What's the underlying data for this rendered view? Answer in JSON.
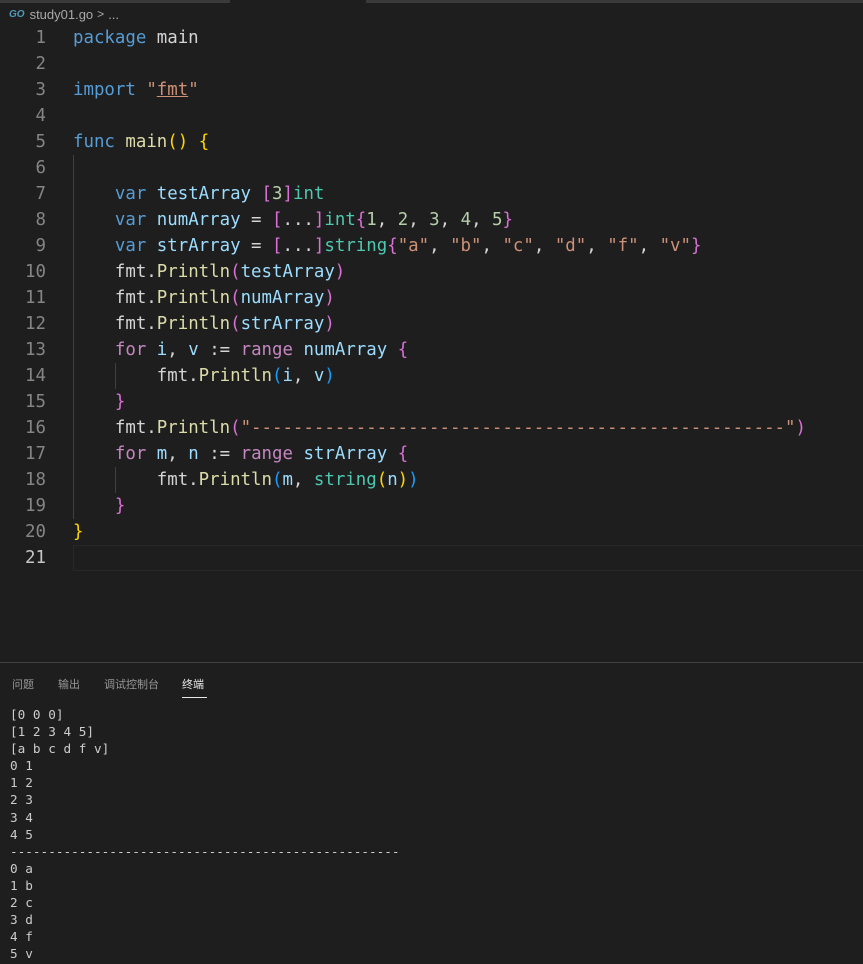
{
  "breadcrumb": {
    "go_icon": "GO",
    "file": "study01.go",
    "sep": ">",
    "more": "..."
  },
  "editor": {
    "line_numbers": [
      "1",
      "2",
      "3",
      "4",
      "5",
      "6",
      "7",
      "8",
      "9",
      "10",
      "11",
      "12",
      "13",
      "14",
      "15",
      "16",
      "17",
      "18",
      "19",
      "20",
      "21"
    ],
    "current_line": "21"
  },
  "panel": {
    "tabs": [
      "问题",
      "输出",
      "调试控制台",
      "终端"
    ],
    "active_tab": "终端",
    "terminal_lines": [
      "[0 0 0]",
      "[1 2 3 4 5]",
      "[a b c d f v]",
      "0 1",
      "1 2",
      "2 3",
      "3 4",
      "4 5",
      "---------------------------------------------------",
      "0 a",
      "1 b",
      "2 c",
      "3 d",
      "4 f",
      "5 v"
    ]
  },
  "colors": {
    "background": "#1e1e1e",
    "keyword": "#569cd6",
    "control": "#c586c0",
    "function": "#dcdcaa",
    "string": "#ce9178",
    "number": "#b5cea8",
    "type": "#4ec9b0",
    "variable": "#9cdcfe"
  },
  "code_lines": [
    [
      [
        "kw",
        "package"
      ],
      [
        "plain",
        " main"
      ]
    ],
    [],
    [
      [
        "kw",
        "import"
      ],
      [
        "plain",
        " "
      ],
      [
        "str",
        "\""
      ],
      [
        "stru",
        "fmt"
      ],
      [
        "str",
        "\""
      ]
    ],
    [],
    [
      [
        "kw",
        "func"
      ],
      [
        "plain",
        " "
      ],
      [
        "fn",
        "main"
      ],
      [
        "b1",
        "()"
      ],
      [
        "plain",
        " "
      ],
      [
        "b1",
        "{"
      ]
    ],
    [],
    [
      [
        "plain",
        "    "
      ],
      [
        "kw",
        "var"
      ],
      [
        "plain",
        " "
      ],
      [
        "var",
        "testArray"
      ],
      [
        "plain",
        " "
      ],
      [
        "b2",
        "["
      ],
      [
        "num",
        "3"
      ],
      [
        "b2",
        "]"
      ],
      [
        "ty",
        "int"
      ]
    ],
    [
      [
        "plain",
        "    "
      ],
      [
        "kw",
        "var"
      ],
      [
        "plain",
        " "
      ],
      [
        "var",
        "numArray"
      ],
      [
        "plain",
        " = "
      ],
      [
        "b2",
        "["
      ],
      [
        "plain",
        "..."
      ],
      [
        "b2",
        "]"
      ],
      [
        "ty",
        "int"
      ],
      [
        "b2",
        "{"
      ],
      [
        "num",
        "1"
      ],
      [
        "plain",
        ", "
      ],
      [
        "num",
        "2"
      ],
      [
        "plain",
        ", "
      ],
      [
        "num",
        "3"
      ],
      [
        "plain",
        ", "
      ],
      [
        "num",
        "4"
      ],
      [
        "plain",
        ", "
      ],
      [
        "num",
        "5"
      ],
      [
        "b2",
        "}"
      ]
    ],
    [
      [
        "plain",
        "    "
      ],
      [
        "kw",
        "var"
      ],
      [
        "plain",
        " "
      ],
      [
        "var",
        "strArray"
      ],
      [
        "plain",
        " = "
      ],
      [
        "b2",
        "["
      ],
      [
        "plain",
        "..."
      ],
      [
        "b2",
        "]"
      ],
      [
        "ty",
        "string"
      ],
      [
        "b2",
        "{"
      ],
      [
        "str",
        "\"a\""
      ],
      [
        "plain",
        ", "
      ],
      [
        "str",
        "\"b\""
      ],
      [
        "plain",
        ", "
      ],
      [
        "str",
        "\"c\""
      ],
      [
        "plain",
        ", "
      ],
      [
        "str",
        "\"d\""
      ],
      [
        "plain",
        ", "
      ],
      [
        "str",
        "\"f\""
      ],
      [
        "plain",
        ", "
      ],
      [
        "str",
        "\"v\""
      ],
      [
        "b2",
        "}"
      ]
    ],
    [
      [
        "plain",
        "    "
      ],
      [
        "plain",
        "fmt."
      ],
      [
        "fn",
        "Println"
      ],
      [
        "b2",
        "("
      ],
      [
        "var",
        "testArray"
      ],
      [
        "b2",
        ")"
      ]
    ],
    [
      [
        "plain",
        "    "
      ],
      [
        "plain",
        "fmt."
      ],
      [
        "fn",
        "Println"
      ],
      [
        "b2",
        "("
      ],
      [
        "var",
        "numArray"
      ],
      [
        "b2",
        ")"
      ]
    ],
    [
      [
        "plain",
        "    "
      ],
      [
        "plain",
        "fmt."
      ],
      [
        "fn",
        "Println"
      ],
      [
        "b2",
        "("
      ],
      [
        "var",
        "strArray"
      ],
      [
        "b2",
        ")"
      ]
    ],
    [
      [
        "plain",
        "    "
      ],
      [
        "ctl",
        "for"
      ],
      [
        "plain",
        " "
      ],
      [
        "var",
        "i"
      ],
      [
        "plain",
        ", "
      ],
      [
        "var",
        "v"
      ],
      [
        "plain",
        " := "
      ],
      [
        "ctl",
        "range"
      ],
      [
        "plain",
        " "
      ],
      [
        "var",
        "numArray"
      ],
      [
        "plain",
        " "
      ],
      [
        "b2",
        "{"
      ]
    ],
    [
      [
        "plain",
        "        "
      ],
      [
        "plain",
        "fmt."
      ],
      [
        "fn",
        "Println"
      ],
      [
        "b3",
        "("
      ],
      [
        "var",
        "i"
      ],
      [
        "plain",
        ", "
      ],
      [
        "var",
        "v"
      ],
      [
        "b3",
        ")"
      ]
    ],
    [
      [
        "plain",
        "    "
      ],
      [
        "b2",
        "}"
      ]
    ],
    [
      [
        "plain",
        "    "
      ],
      [
        "plain",
        "fmt."
      ],
      [
        "fn",
        "Println"
      ],
      [
        "b2",
        "("
      ],
      [
        "str",
        "\"---------------------------------------------------\""
      ],
      [
        "b2",
        ")"
      ]
    ],
    [
      [
        "plain",
        "    "
      ],
      [
        "ctl",
        "for"
      ],
      [
        "plain",
        " "
      ],
      [
        "var",
        "m"
      ],
      [
        "plain",
        ", "
      ],
      [
        "var",
        "n"
      ],
      [
        "plain",
        " := "
      ],
      [
        "ctl",
        "range"
      ],
      [
        "plain",
        " "
      ],
      [
        "var",
        "strArray"
      ],
      [
        "plain",
        " "
      ],
      [
        "b2",
        "{"
      ]
    ],
    [
      [
        "plain",
        "        "
      ],
      [
        "plain",
        "fmt."
      ],
      [
        "fn",
        "Println"
      ],
      [
        "b3",
        "("
      ],
      [
        "var",
        "m"
      ],
      [
        "plain",
        ", "
      ],
      [
        "ty",
        "string"
      ],
      [
        "b1",
        "("
      ],
      [
        "var",
        "n"
      ],
      [
        "b1",
        ")"
      ],
      [
        "b3",
        ")"
      ]
    ],
    [
      [
        "plain",
        "    "
      ],
      [
        "b2",
        "}"
      ]
    ],
    [
      [
        "b1",
        "}"
      ]
    ],
    []
  ]
}
